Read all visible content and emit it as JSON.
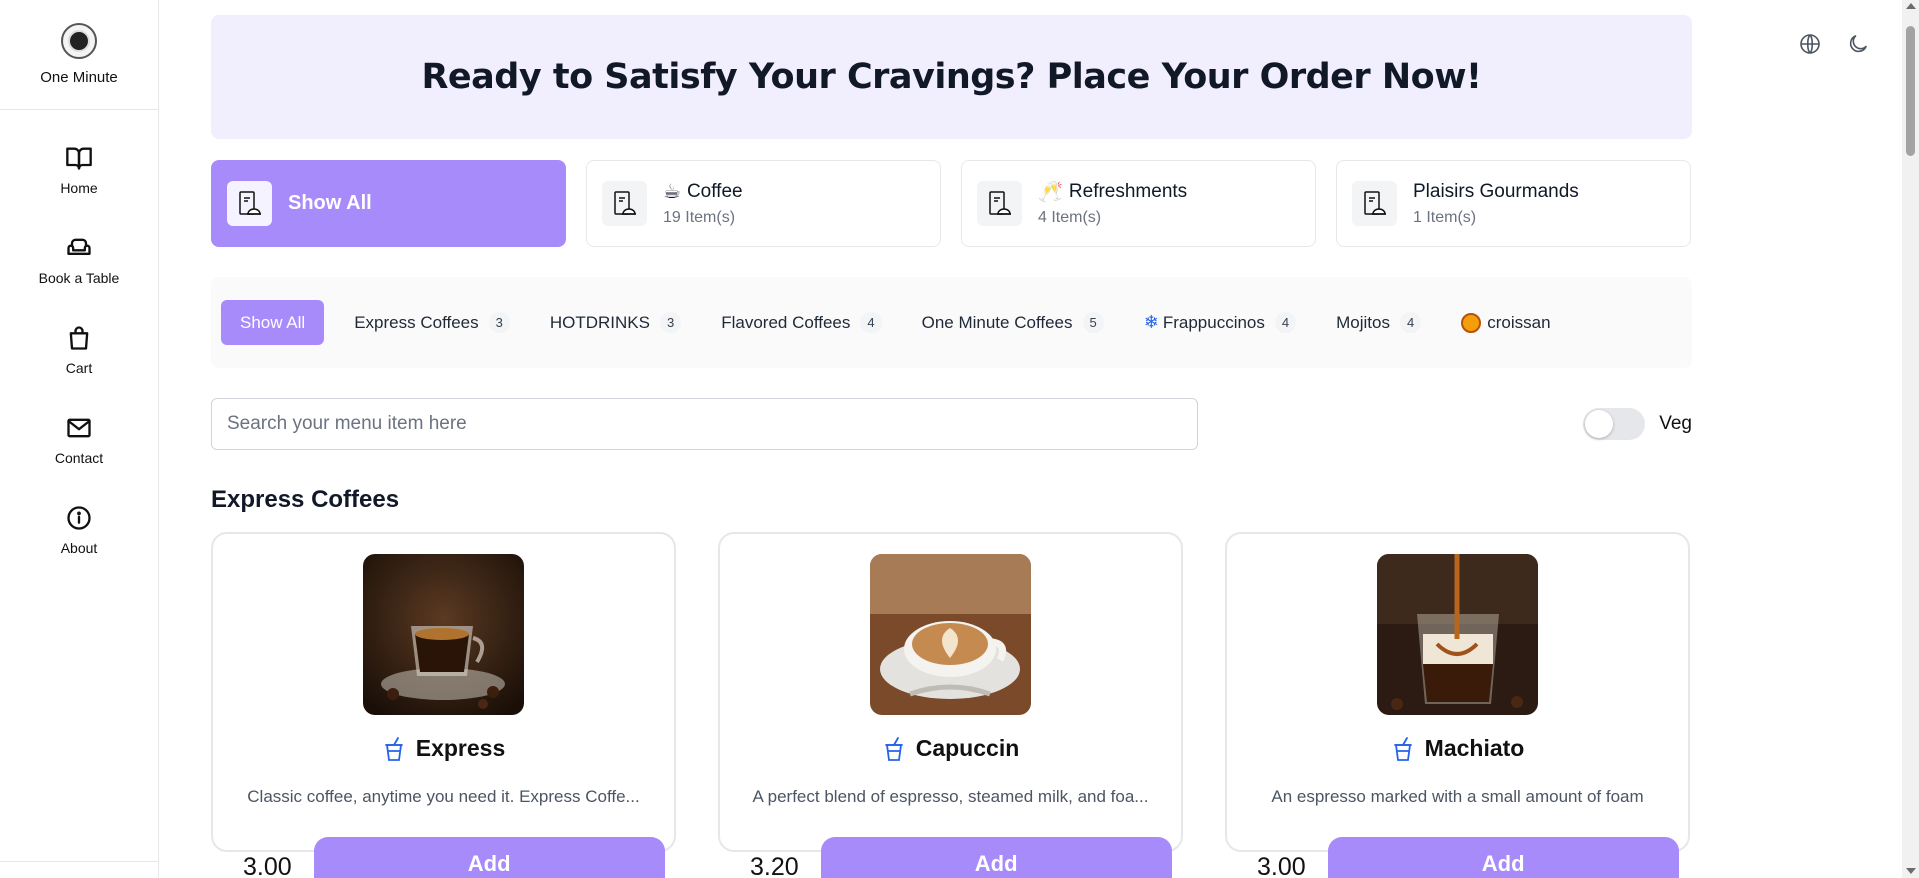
{
  "brand": {
    "name": "One Minute"
  },
  "nav": [
    {
      "label": "Home",
      "icon": "book-open-icon"
    },
    {
      "label": "Book a Table",
      "icon": "sofa-icon"
    },
    {
      "label": "Cart",
      "icon": "shopping-bag-icon"
    },
    {
      "label": "Contact",
      "icon": "mail-icon"
    },
    {
      "label": "About",
      "icon": "info-icon"
    }
  ],
  "hero": {
    "title": "Ready to Satisfy Your Cravings? Place Your Order Now!"
  },
  "categories": [
    {
      "title": "Show All",
      "count": "",
      "emoji": ""
    },
    {
      "title": "Coffee",
      "count": "19 Item(s)",
      "emoji": "☕"
    },
    {
      "title": "Refreshments",
      "count": "4 Item(s)",
      "emoji": "🥂"
    },
    {
      "title": "Plaisirs Gourmands",
      "count": "1 Item(s)",
      "emoji": ""
    }
  ],
  "subcategories": [
    {
      "label": "Show All",
      "count": ""
    },
    {
      "label": "Express Coffees",
      "count": "3"
    },
    {
      "label": "HOTDRINKS",
      "count": "3"
    },
    {
      "label": "Flavored Coffees",
      "count": "4"
    },
    {
      "label": "One Minute Coffees",
      "count": "5"
    },
    {
      "label": "Frappuccinos",
      "count": "4",
      "icon": "❄"
    },
    {
      "label": "Mojitos",
      "count": "4"
    },
    {
      "label": "croissan",
      "count": ""
    }
  ],
  "search": {
    "placeholder": "Search your menu item here",
    "value": ""
  },
  "veg": {
    "label": "Veg",
    "enabled": false
  },
  "section": {
    "title": "Express Coffees"
  },
  "items": [
    {
      "name": "Express",
      "description": "Classic coffee, anytime you need it. Express Coffe...",
      "price": "3.00",
      "add_label": "Add"
    },
    {
      "name": "Capuccin",
      "description": "A perfect blend of espresso, steamed milk, and foa...",
      "price": "3.20",
      "add_label": "Add"
    },
    {
      "name": "Machiato",
      "description": "An espresso marked with a small amount of foam",
      "price": "3.00",
      "add_label": "Add"
    }
  ],
  "colors": {
    "accent": "#a78bfa",
    "hero_bg": "#f1effd"
  }
}
